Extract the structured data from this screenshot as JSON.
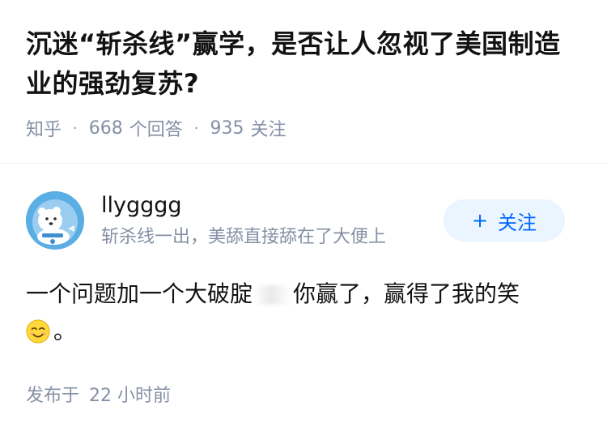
{
  "question": {
    "title": "沉迷“斩杀线”赢学，是否让人忽视了美国制造业的强劲复苏?",
    "source": "知乎",
    "answer_count": "668",
    "answer_label": "个回答",
    "follow_count": "935",
    "follow_label": "关注",
    "separator": "·"
  },
  "author": {
    "name": "llygggg",
    "bio": "斩杀线一出，美舔直接舔在了大便上",
    "follow_button_label": "关注",
    "follow_button_icon": "plus-icon",
    "avatar_icon": "polar-bear-astronaut-avatar"
  },
  "answer": {
    "text_part1": "一个问题加一个大破腚",
    "text_part2": "你赢了，赢得了我的笑",
    "emoji_icon": "smiling-face-icon",
    "text_part3": "。"
  },
  "footer": {
    "posted_label": "发布于",
    "time_ago": "22 小时前"
  },
  "colors": {
    "accent": "#0066ff",
    "follow_bg": "#ebf5ff",
    "muted": "#8590a6",
    "text": "#121212",
    "avatar_bg": "#5aaee4"
  }
}
